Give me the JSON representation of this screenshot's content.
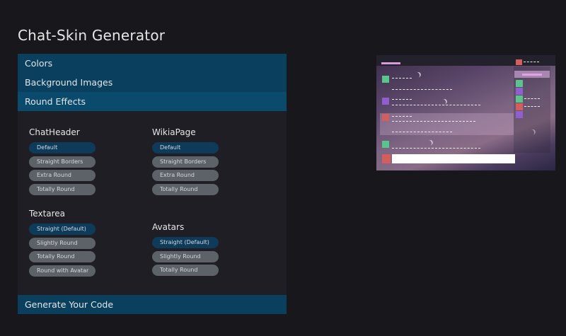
{
  "page": {
    "title": "Chat-Skin Generator"
  },
  "sections": {
    "colors": "Colors",
    "background_images": "Background Images",
    "round_effects": "Round Effects",
    "generate": "Generate Your Code"
  },
  "groups": {
    "chat_header": {
      "title": "ChatHeader",
      "options": [
        "Default",
        "Straight Borders",
        "Extra Round",
        "Totally Round"
      ],
      "selected": "Default"
    },
    "wikia_page": {
      "title": "WikiaPage",
      "options": [
        "Default",
        "Straight Borders",
        "Extra Round",
        "Totally Round"
      ],
      "selected": "Default"
    },
    "textarea": {
      "title": "Textarea",
      "options": [
        "Straight (Default)",
        "Slightly Round",
        "Totally Round",
        "Round with Avatar"
      ],
      "selected": "Straight (Default)"
    },
    "avatars": {
      "title": "Avatars",
      "options": [
        "Straight (Default)",
        "Slightly Round",
        "Totally Round"
      ],
      "selected": "Straight (Default)"
    }
  },
  "colors": {
    "background": "#18171c",
    "panel": "#1f1e25",
    "header_bar": "#0b3f5e",
    "pill": "#5d6268",
    "pill_selected": "#0e3b59",
    "preview_green": "#5bc48c",
    "preview_purple": "#8e5fcd",
    "preview_red": "#d35e5e",
    "preview_pink": "#d79bdc"
  }
}
